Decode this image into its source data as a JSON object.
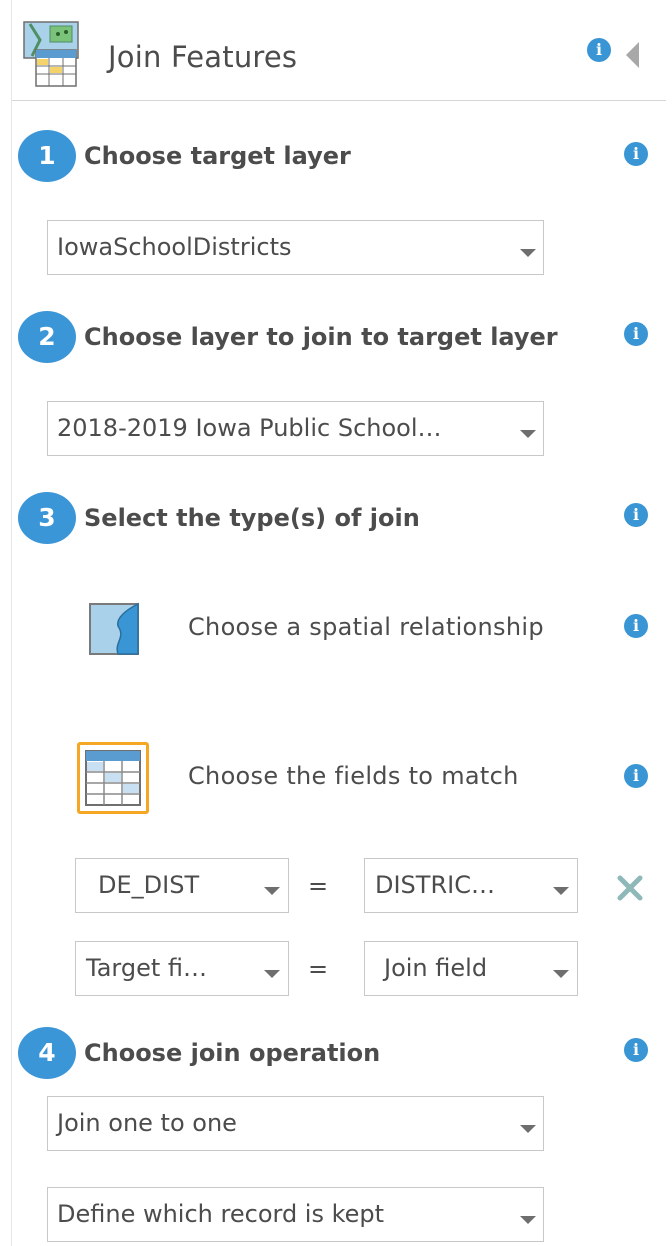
{
  "header": {
    "title": "Join Features"
  },
  "icons": {
    "tool": "join-features-icon",
    "info": "info-icon",
    "collapse": "collapse-left-icon",
    "spatial": "spatial-relationship-icon",
    "fields": "attribute-table-icon",
    "remove": "close-x-icon"
  },
  "colors": {
    "accent": "#3b96d7",
    "selected_border": "#f5a623",
    "remove": "#8fb8b8"
  },
  "steps": [
    {
      "number": "1",
      "label": "Choose target layer",
      "dropdown": "IowaSchoolDistricts"
    },
    {
      "number": "2",
      "label": "Choose layer to join to target layer",
      "dropdown": "2018-2019 Iowa Public School…"
    },
    {
      "number": "3",
      "label": "Select the type(s) of join"
    },
    {
      "number": "4",
      "label": "Choose join operation",
      "dropdown": "Join one to one",
      "dropdown2": "Define which record is kept"
    }
  ],
  "join_types": {
    "spatial": "Choose a spatial relationship",
    "fields": "Choose the fields to match"
  },
  "field_match_rows": [
    {
      "target": "DE_DIST",
      "operator": "=",
      "join": "DISTRIC…"
    },
    {
      "target": "Target fi…",
      "operator": "=",
      "join": "Join field"
    }
  ]
}
